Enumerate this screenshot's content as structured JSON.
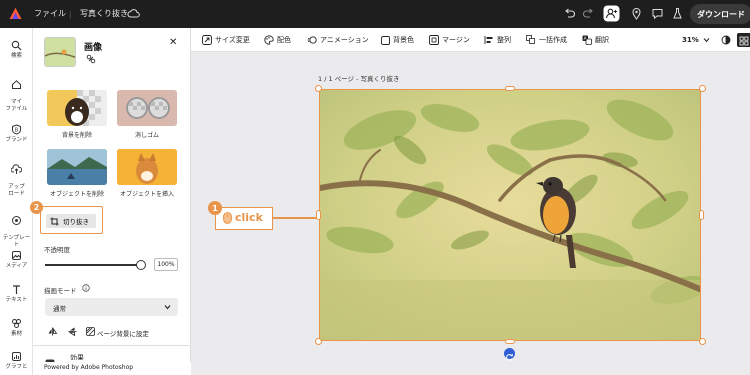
{
  "topbar": {
    "file_menu": "ファイル",
    "doc_title": "写真くり抜き",
    "download": "ダウンロード"
  },
  "rail": [
    {
      "label": "検索",
      "icon": "search-icon"
    },
    {
      "label": "マイ\nファイル",
      "icon": "home-icon"
    },
    {
      "label": "ブランド",
      "icon": "brand-icon"
    },
    {
      "label": "アップ\nロード",
      "icon": "upload-icon"
    },
    {
      "label": "テンプレー\nト",
      "icon": "template-icon"
    },
    {
      "label": "メディア",
      "icon": "media-icon"
    },
    {
      "label": "テキスト",
      "icon": "text-icon"
    },
    {
      "label": "素材",
      "icon": "elements-icon"
    },
    {
      "label": "グラフと",
      "icon": "chart-icon"
    }
  ],
  "panel": {
    "title": "画像",
    "close": "✕",
    "actions": [
      {
        "label": "背景を削除"
      },
      {
        "label": "消しゴム"
      },
      {
        "label": "オブジェクトを削除"
      },
      {
        "label": "オブジェクトを挿入"
      }
    ],
    "crop_label": "切り抜き",
    "opacity_label": "不透明度",
    "opacity_value": "100%",
    "opacity_level": 1.0,
    "blend_label": "描画モード",
    "blend_value": "通常",
    "bg_label": "ページ背景に設定",
    "partial_label": "効果",
    "powered": "Powered by Adobe Photoshop"
  },
  "toolbar": {
    "items": [
      "サイズ変更",
      "配色",
      "アニメーション",
      "背景色",
      "マージン",
      "整列",
      "一括作成",
      "翻訳"
    ],
    "zoom": "31%"
  },
  "canvas": {
    "page_label": "1 / 1 ページ - 写真くり抜き"
  },
  "callouts": {
    "step1": "1",
    "step1_text": "click",
    "step2": "2"
  },
  "colors": {
    "accent": "#e8944a",
    "topbar": "#1e1e1e",
    "rotate": "#2f5fd6"
  }
}
